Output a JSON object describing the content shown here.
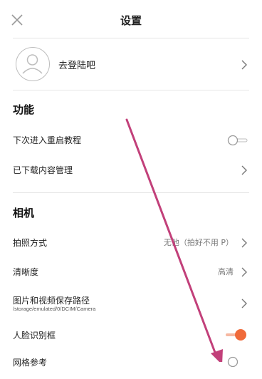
{
  "header": {
    "title": "设置",
    "close_icon": "close-icon"
  },
  "account": {
    "login_label": "去登陆吧",
    "avatar_icon": "avatar-icon"
  },
  "sections": {
    "features": {
      "title": "功能",
      "tutorial_label": "下次进入重启教程",
      "tutorial_enabled": false,
      "downloads_label": "已下载内容管理"
    },
    "camera": {
      "title": "相机",
      "mode_label": "拍照方式",
      "mode_value": "无他（拍好不用 P）",
      "resolution_label": "清晰度",
      "resolution_value": "高清",
      "path_label": "图片和视频保存路径",
      "path_value": "/storage/emulated/0/DCIM/Camera",
      "face_label": "人脸识别框",
      "face_enabled": true,
      "next_label": "网格参考"
    }
  },
  "colors": {
    "accent": "#f06a3a",
    "annotation_arrow": "#c2407a",
    "divider": "#e6e6e6"
  }
}
